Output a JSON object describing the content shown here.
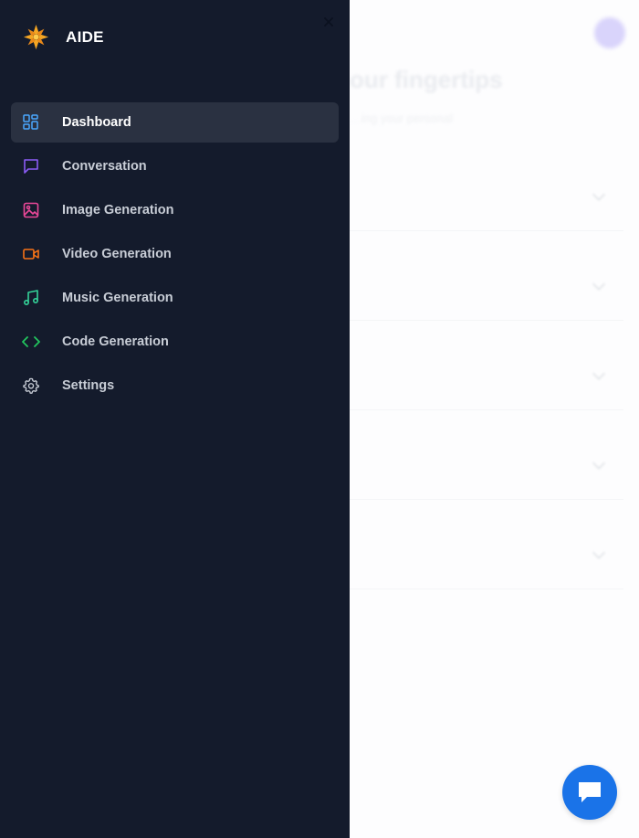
{
  "app": {
    "name": "AIDE"
  },
  "background": {
    "title": "our fingertips",
    "subtitle": "…ing your personal"
  },
  "sidebar": {
    "items": [
      {
        "label": "Dashboard",
        "icon": "dashboard-icon",
        "color": "#4aa8ff",
        "active": true
      },
      {
        "label": "Conversation",
        "icon": "chat-icon",
        "color": "#8b5cf6",
        "active": false
      },
      {
        "label": "Image Generation",
        "icon": "image-icon",
        "color": "#ec4899",
        "active": false
      },
      {
        "label": "Video Generation",
        "icon": "video-icon",
        "color": "#f97316",
        "active": false
      },
      {
        "label": "Music Generation",
        "icon": "music-icon",
        "color": "#34d399",
        "active": false
      },
      {
        "label": "Code Generation",
        "icon": "code-icon",
        "color": "#22c55e",
        "active": false
      },
      {
        "label": "Settings",
        "icon": "gear-icon",
        "color": "#c8cdd6",
        "active": false
      }
    ]
  },
  "colors": {
    "drawer_bg": "#141b2c",
    "active_item_bg": "#2a3141",
    "fab": "#1a73e8"
  }
}
